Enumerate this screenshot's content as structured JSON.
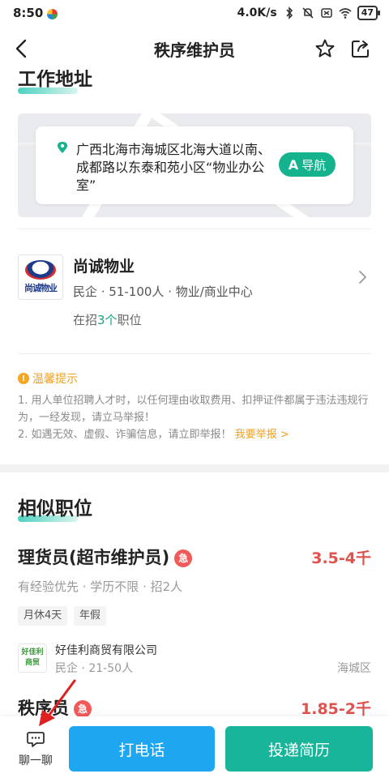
{
  "status_bar": {
    "time": "8:50",
    "net_speed": "4.0K/s",
    "battery": "47"
  },
  "header": {
    "title": "秩序维护员"
  },
  "work_address": {
    "section_title": "工作地址",
    "address": "广西北海市海城区北海大道以南、成都路以东泰和苑小区“物业办公室”",
    "nav_label": "导航"
  },
  "company": {
    "logo_text": "尚诚物业",
    "name": "尚诚物业",
    "meta": "民企 · 51-100人 · 物业/商业中心",
    "jobs_prefix": "在招",
    "jobs_count": "3个",
    "jobs_suffix": "职位"
  },
  "tips": {
    "title": "温馨提示",
    "line1": "1. 用人单位招聘人才时，以任何理由收取费用、扣押证件都属于违法违规行为，一经发现，请立马举报！",
    "line2": "2. 如遇无效、虚假、诈骗信息，请立即举报！",
    "report_link": "我要举报 >"
  },
  "similar": {
    "section_title": "相似职位",
    "jobs": [
      {
        "title": "理货员(超市维护员)",
        "urgent": "急",
        "salary": "3.5-4千",
        "meta": "有经验优先 · 学历不限 · 招2人",
        "tags": [
          "月休4天",
          "年假"
        ],
        "company_logo": "好佳利商贸",
        "company": "好佳利商贸有限公司",
        "company_meta": "民企 · 21-50人",
        "area": "海城区"
      },
      {
        "title": "秩序员",
        "urgent": "急",
        "salary": "1.85-2千"
      }
    ]
  },
  "bottom_bar": {
    "chat_label": "聊一聊",
    "call_label": "打电话",
    "resume_label": "投递简历"
  },
  "colors": {
    "accent_green": "#18b59a",
    "call_blue": "#1ea7f0",
    "salary_red": "#e0524d",
    "tip_orange": "#f0a020"
  }
}
